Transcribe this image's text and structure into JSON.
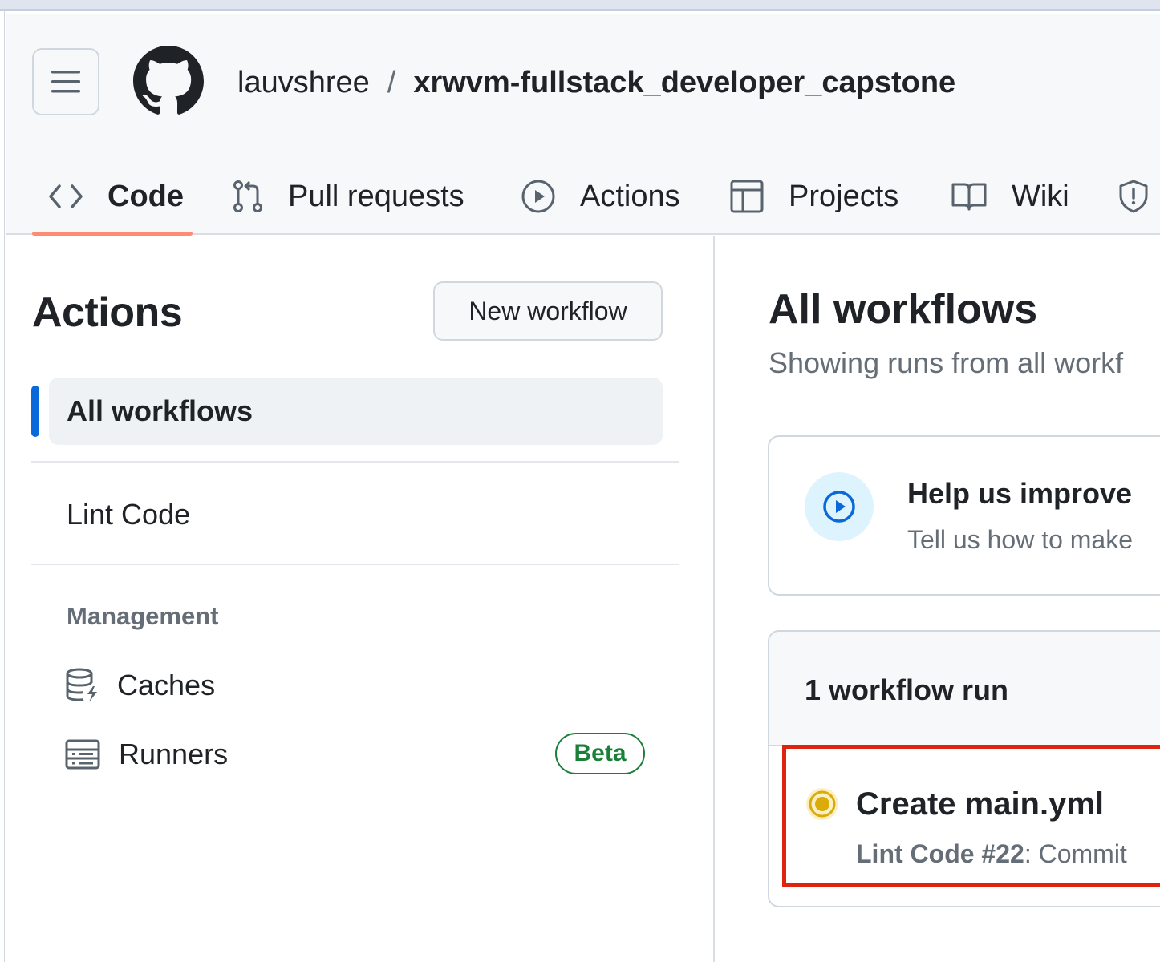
{
  "repo": {
    "owner": "lauvshree",
    "separator": "/",
    "name": "xrwvm-fullstack_developer_capstone"
  },
  "tabs": [
    {
      "label": "Code",
      "icon": "code-icon",
      "selected": true
    },
    {
      "label": "Pull requests",
      "icon": "git-pull-request-icon",
      "selected": false
    },
    {
      "label": "Actions",
      "icon": "play-icon",
      "selected": false
    },
    {
      "label": "Projects",
      "icon": "table-icon",
      "selected": false
    },
    {
      "label": "Wiki",
      "icon": "book-icon",
      "selected": false
    },
    {
      "label": "",
      "icon": "shield-icon",
      "selected": false
    }
  ],
  "sidebar": {
    "title": "Actions",
    "new_workflow_label": "New workflow",
    "active_item": "All workflows",
    "items": [
      "Lint Code"
    ],
    "management": {
      "label": "Management",
      "items": [
        {
          "label": "Caches",
          "icon": "database-icon"
        },
        {
          "label": "Runners",
          "icon": "server-icon",
          "badge": "Beta"
        }
      ]
    }
  },
  "main": {
    "title": "All workflows",
    "subtitle": "Showing runs from all workf",
    "feedback": {
      "title": "Help us improve",
      "text": "Tell us how to make"
    },
    "runs": {
      "count_label": "1 workflow run",
      "items": [
        {
          "title": "Create main.yml",
          "workflow": "Lint Code",
          "run_number": "#22",
          "detail": ": Commit",
          "status": "in-progress"
        }
      ]
    }
  },
  "colors": {
    "accent_blue": "#0969da",
    "tab_underline": "#fd8c73",
    "badge_green": "#1a7f37",
    "status_yellow": "#dbab09",
    "highlight_red": "#e0230e"
  }
}
